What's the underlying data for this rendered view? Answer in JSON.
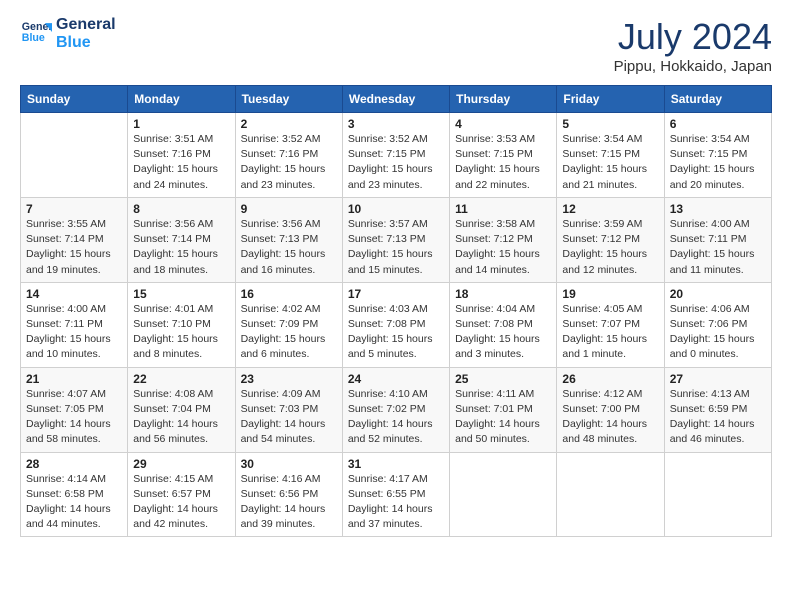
{
  "header": {
    "logo_line1": "General",
    "logo_line2": "Blue",
    "title": "July 2024",
    "subtitle": "Pippu, Hokkaido, Japan"
  },
  "calendar": {
    "columns": [
      "Sunday",
      "Monday",
      "Tuesday",
      "Wednesday",
      "Thursday",
      "Friday",
      "Saturday"
    ],
    "weeks": [
      [
        {
          "day": "",
          "info": ""
        },
        {
          "day": "1",
          "info": "Sunrise: 3:51 AM\nSunset: 7:16 PM\nDaylight: 15 hours\nand 24 minutes."
        },
        {
          "day": "2",
          "info": "Sunrise: 3:52 AM\nSunset: 7:16 PM\nDaylight: 15 hours\nand 23 minutes."
        },
        {
          "day": "3",
          "info": "Sunrise: 3:52 AM\nSunset: 7:15 PM\nDaylight: 15 hours\nand 23 minutes."
        },
        {
          "day": "4",
          "info": "Sunrise: 3:53 AM\nSunset: 7:15 PM\nDaylight: 15 hours\nand 22 minutes."
        },
        {
          "day": "5",
          "info": "Sunrise: 3:54 AM\nSunset: 7:15 PM\nDaylight: 15 hours\nand 21 minutes."
        },
        {
          "day": "6",
          "info": "Sunrise: 3:54 AM\nSunset: 7:15 PM\nDaylight: 15 hours\nand 20 minutes."
        }
      ],
      [
        {
          "day": "7",
          "info": "Sunrise: 3:55 AM\nSunset: 7:14 PM\nDaylight: 15 hours\nand 19 minutes."
        },
        {
          "day": "8",
          "info": "Sunrise: 3:56 AM\nSunset: 7:14 PM\nDaylight: 15 hours\nand 18 minutes."
        },
        {
          "day": "9",
          "info": "Sunrise: 3:56 AM\nSunset: 7:13 PM\nDaylight: 15 hours\nand 16 minutes."
        },
        {
          "day": "10",
          "info": "Sunrise: 3:57 AM\nSunset: 7:13 PM\nDaylight: 15 hours\nand 15 minutes."
        },
        {
          "day": "11",
          "info": "Sunrise: 3:58 AM\nSunset: 7:12 PM\nDaylight: 15 hours\nand 14 minutes."
        },
        {
          "day": "12",
          "info": "Sunrise: 3:59 AM\nSunset: 7:12 PM\nDaylight: 15 hours\nand 12 minutes."
        },
        {
          "day": "13",
          "info": "Sunrise: 4:00 AM\nSunset: 7:11 PM\nDaylight: 15 hours\nand 11 minutes."
        }
      ],
      [
        {
          "day": "14",
          "info": "Sunrise: 4:00 AM\nSunset: 7:11 PM\nDaylight: 15 hours\nand 10 minutes."
        },
        {
          "day": "15",
          "info": "Sunrise: 4:01 AM\nSunset: 7:10 PM\nDaylight: 15 hours\nand 8 minutes."
        },
        {
          "day": "16",
          "info": "Sunrise: 4:02 AM\nSunset: 7:09 PM\nDaylight: 15 hours\nand 6 minutes."
        },
        {
          "day": "17",
          "info": "Sunrise: 4:03 AM\nSunset: 7:08 PM\nDaylight: 15 hours\nand 5 minutes."
        },
        {
          "day": "18",
          "info": "Sunrise: 4:04 AM\nSunset: 7:08 PM\nDaylight: 15 hours\nand 3 minutes."
        },
        {
          "day": "19",
          "info": "Sunrise: 4:05 AM\nSunset: 7:07 PM\nDaylight: 15 hours\nand 1 minute."
        },
        {
          "day": "20",
          "info": "Sunrise: 4:06 AM\nSunset: 7:06 PM\nDaylight: 15 hours\nand 0 minutes."
        }
      ],
      [
        {
          "day": "21",
          "info": "Sunrise: 4:07 AM\nSunset: 7:05 PM\nDaylight: 14 hours\nand 58 minutes."
        },
        {
          "day": "22",
          "info": "Sunrise: 4:08 AM\nSunset: 7:04 PM\nDaylight: 14 hours\nand 56 minutes."
        },
        {
          "day": "23",
          "info": "Sunrise: 4:09 AM\nSunset: 7:03 PM\nDaylight: 14 hours\nand 54 minutes."
        },
        {
          "day": "24",
          "info": "Sunrise: 4:10 AM\nSunset: 7:02 PM\nDaylight: 14 hours\nand 52 minutes."
        },
        {
          "day": "25",
          "info": "Sunrise: 4:11 AM\nSunset: 7:01 PM\nDaylight: 14 hours\nand 50 minutes."
        },
        {
          "day": "26",
          "info": "Sunrise: 4:12 AM\nSunset: 7:00 PM\nDaylight: 14 hours\nand 48 minutes."
        },
        {
          "day": "27",
          "info": "Sunrise: 4:13 AM\nSunset: 6:59 PM\nDaylight: 14 hours\nand 46 minutes."
        }
      ],
      [
        {
          "day": "28",
          "info": "Sunrise: 4:14 AM\nSunset: 6:58 PM\nDaylight: 14 hours\nand 44 minutes."
        },
        {
          "day": "29",
          "info": "Sunrise: 4:15 AM\nSunset: 6:57 PM\nDaylight: 14 hours\nand 42 minutes."
        },
        {
          "day": "30",
          "info": "Sunrise: 4:16 AM\nSunset: 6:56 PM\nDaylight: 14 hours\nand 39 minutes."
        },
        {
          "day": "31",
          "info": "Sunrise: 4:17 AM\nSunset: 6:55 PM\nDaylight: 14 hours\nand 37 minutes."
        },
        {
          "day": "",
          "info": ""
        },
        {
          "day": "",
          "info": ""
        },
        {
          "day": "",
          "info": ""
        }
      ]
    ]
  }
}
